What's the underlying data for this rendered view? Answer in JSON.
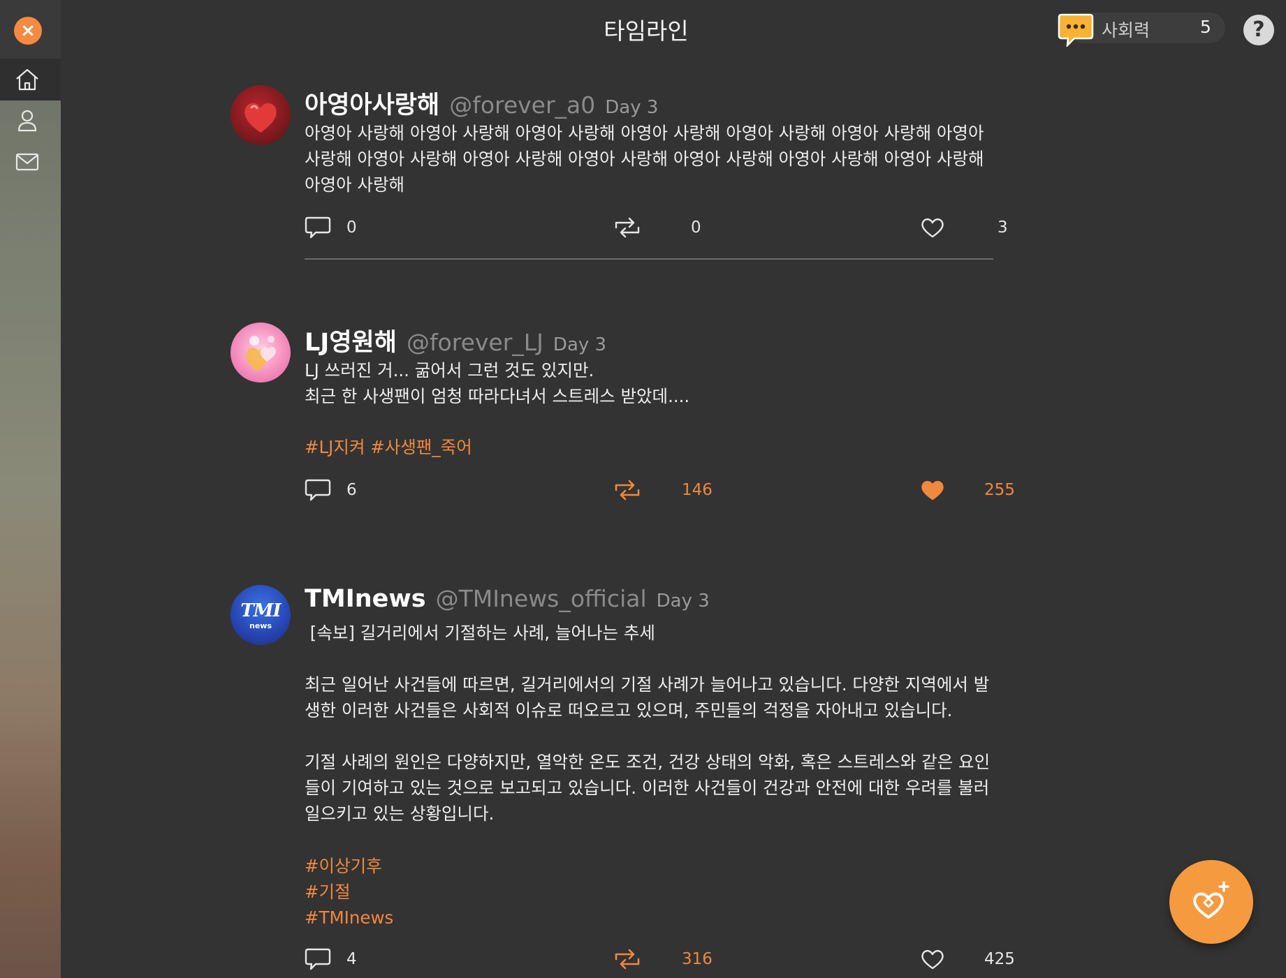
{
  "header": {
    "title": "타임라인"
  },
  "social": {
    "label": "사회력",
    "count": "5"
  },
  "nav": {
    "close": "×",
    "help": "?"
  },
  "posts": [
    {
      "author": "아영아사랑해",
      "handle": "@forever_a0",
      "day": "Day 3",
      "body": "아영아 사랑해 아영아 사랑해 아영아 사랑해 아영아 사랑해 아영아 사랑해 아영아 사랑해 아영아 사랑해 아영아 사랑해 아영아 사랑해 아영아 사랑해 아영아 사랑해 아영아 사랑해 아영아 사랑해 아영아 사랑해",
      "tags": "",
      "comments": "0",
      "reposts": "0",
      "likes": "3",
      "liked": false,
      "reposted": false
    },
    {
      "author": "LJ영원해",
      "handle": "@forever_LJ",
      "day": "Day 3",
      "body": "LJ 쓰러진 거... 굶어서 그런 것도 있지만.\n최근 한 사생팬이 엄청 따라다녀서 스트레스 받았데....",
      "tags": "#LJ지켜 #사생팬_죽어",
      "comments": "6",
      "reposts": "146",
      "likes": "255",
      "liked": true,
      "reposted": true
    },
    {
      "author": "TMInews",
      "handle": "@TMInews_official",
      "day": "Day 3",
      "body": " [속보] 길거리에서 기절하는 사례, 늘어나는 추세\n\n최근 일어난 사건들에 따르면, 길거리에서의 기절 사례가 늘어나고 있습니다. 다양한 지역에서 발생한 이러한 사건들은 사회적 이슈로 떠오르고 있으며, 주민들의 걱정을 자아내고 있습니다.\n\n기절 사례의 원인은 다양하지만, 열악한 온도 조건, 건강 상태의 악화, 혹은 스트레스와 같은 요인들이 기여하고 있는 것으로 보고되고 있습니다. 이러한 사건들이 건강과 안전에 대한 우려를 불러일으키고 있는 상황입니다.",
      "tags": "#이상기후\n#기절\n#TMInews",
      "avatar_text": "TMI",
      "avatar_sub": "news",
      "comments": "4",
      "reposts": "316",
      "likes": "425",
      "liked": false,
      "reposted": true
    }
  ],
  "colors": {
    "accent": "#f0883e",
    "background": "#333333",
    "fab": "#f59a3f"
  },
  "icons": [
    "close-icon",
    "home-icon",
    "profile-icon",
    "mail-icon",
    "chat-icon",
    "help-icon",
    "comment-icon",
    "repost-icon",
    "heart-icon",
    "heart-sparkle-icon"
  ]
}
